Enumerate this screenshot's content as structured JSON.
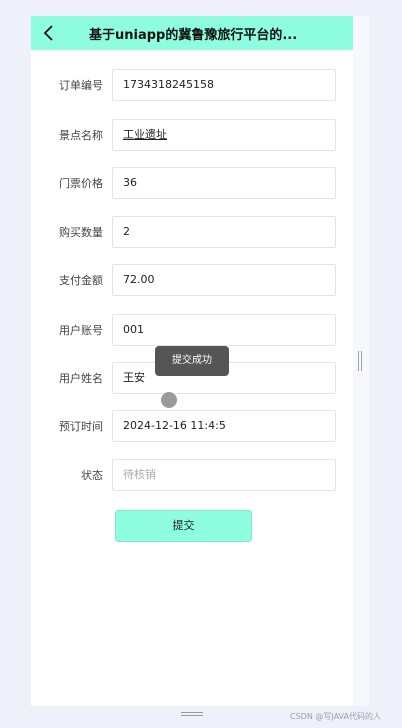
{
  "header": {
    "title": "基于uniapp的冀鲁豫旅行平台的..."
  },
  "form": {
    "fields": [
      {
        "label": "订单编号",
        "value": "1734318245158"
      },
      {
        "label": "景点名称",
        "value": "工业遗址"
      },
      {
        "label": "门票价格",
        "value": "36"
      },
      {
        "label": "购买数量",
        "value": "2"
      },
      {
        "label": "支付金额",
        "value": "72.00"
      },
      {
        "label": "用户账号",
        "value": "001"
      },
      {
        "label": "用户姓名",
        "value": "王安"
      },
      {
        "label": "预订时间",
        "value": "2024-12-16 11:4:5"
      },
      {
        "label": "状态",
        "placeholder": "待核销"
      }
    ],
    "submit_label": "提交"
  },
  "toast": {
    "text": "提交成功"
  },
  "watermark": "CSDN @写JAVA代码的人"
}
